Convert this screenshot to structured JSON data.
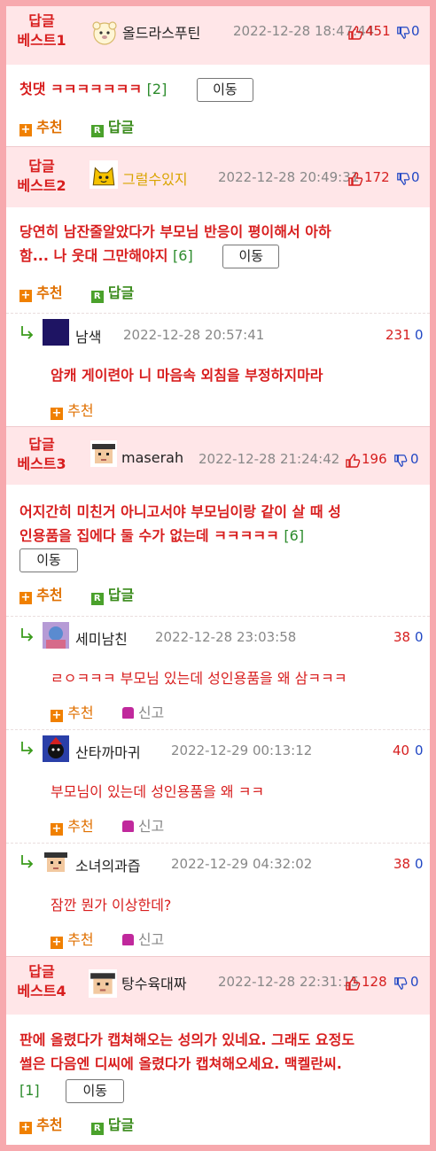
{
  "common": {
    "move_label": "이동",
    "recommend_label": "추천",
    "reply_label": "답글",
    "report_label": "신고"
  },
  "best": [
    {
      "label_line1": "답글",
      "label_line2": "베스트1",
      "nick": "올드라스푸틴",
      "date": "2022-12-28 18:47:44",
      "up": "451",
      "down": "0",
      "body": "첫댓 ㅋㅋㅋㅋㅋㅋㅋ",
      "reply_count": "[2]"
    },
    {
      "label_line1": "답글",
      "label_line2": "베스트2",
      "nick": "그럴수있지",
      "date": "2022-12-28 20:49:31",
      "up": "172",
      "down": "0",
      "body_line1": "당연히 남잔줄알았다가 부모님 반응이 평이해서 아하",
      "body_line2": "함... 나 웃대 그만해야지",
      "reply_count": "[6]"
    },
    {
      "label_line1": "답글",
      "label_line2": "베스트3",
      "nick": "maserah",
      "date": "2022-12-28 21:24:42",
      "up": "196",
      "down": "0",
      "body_line1": "어지간히 미친거 아니고서야 부모님이랑 같이 살 때 성",
      "body_line2": "인용품을 집에다 둘 수가 없는데 ㅋㅋㅋㅋㅋ",
      "reply_count": "[6]"
    },
    {
      "label_line1": "답글",
      "label_line2": "베스트4",
      "nick": "탕수육대짜",
      "date": "2022-12-28 22:31:15",
      "up": "128",
      "down": "0",
      "body_line1": "판에 올렸다가 캡쳐해오는 성의가 있네요. 그래도 요정도",
      "body_line2": "썰은 다음엔 디씨에 올렸다가 캡쳐해오세요. 맥켈란씨.",
      "reply_count": "[1]"
    }
  ],
  "replies": [
    {
      "nick": "남색",
      "date": "2022-12-28 20:57:41",
      "up": "231",
      "down": "0",
      "body": "암캐 게이련아 니 마음속 외침을 부정하지마라"
    },
    {
      "nick": "세미남친",
      "date": "2022-12-28 23:03:58",
      "up": "38",
      "down": "0",
      "body": "ㄹㅇㅋㅋㅋ 부모님 있는데 성인용품을 왜 삼ㅋㅋㅋ"
    },
    {
      "nick": "산타까마귀",
      "date": "2022-12-29 00:13:12",
      "up": "40",
      "down": "0",
      "body": "부모님이 있는데 성인용품을 왜 ㅋㅋ"
    },
    {
      "nick": "소녀의과즙",
      "date": "2022-12-29 04:32:02",
      "up": "38",
      "down": "0",
      "body": "잠깐 뭔가 이상한데?"
    }
  ]
}
